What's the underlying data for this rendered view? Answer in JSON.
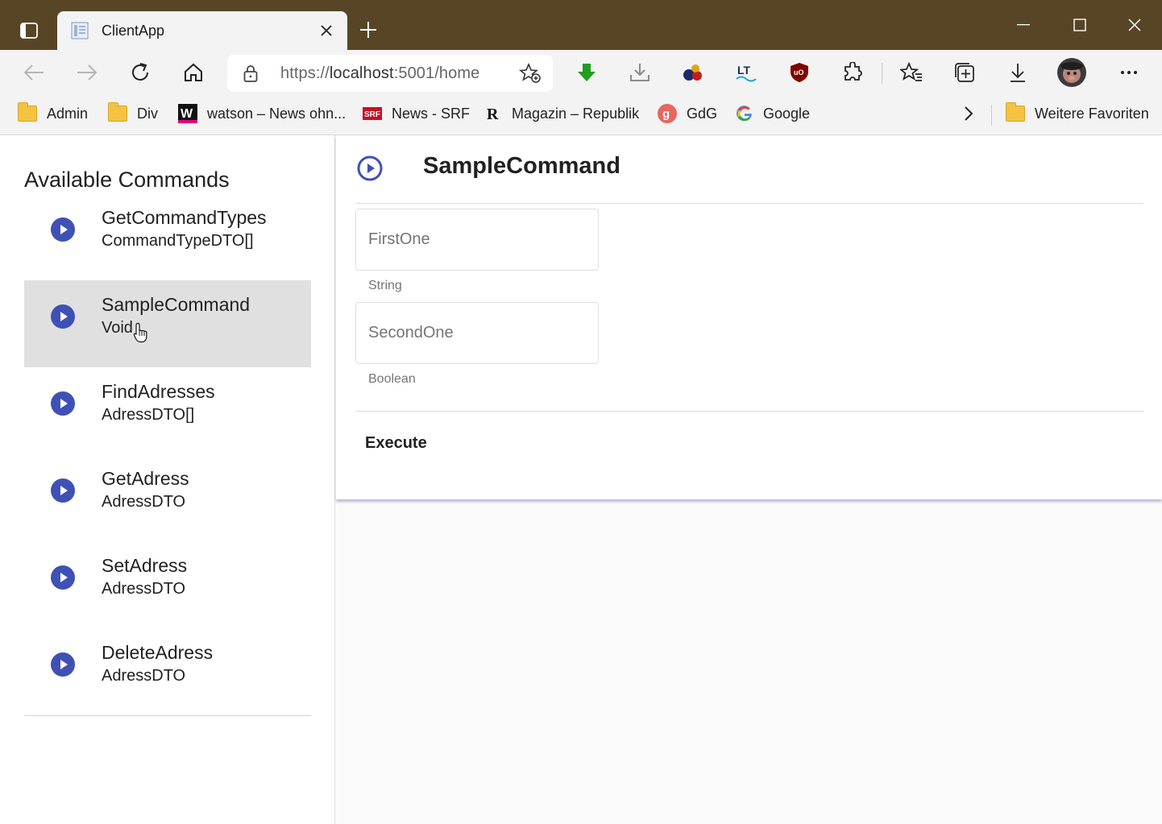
{
  "browser": {
    "tab": {
      "title": "ClientApp"
    },
    "address": {
      "scheme_host": "https://",
      "host": "localhost",
      "rest": ":5001/home"
    },
    "bookmarks": [
      {
        "label": "Admin",
        "icon": "folder-icon"
      },
      {
        "label": "Div",
        "icon": "folder-icon"
      },
      {
        "label": "watson – News ohn...",
        "icon": "watson-icon"
      },
      {
        "label": "News - SRF",
        "icon": "srf-icon"
      },
      {
        "label": "Magazin – Republik",
        "icon": "republik-icon"
      },
      {
        "label": "GdG",
        "icon": "gdg-icon"
      },
      {
        "label": "Google",
        "icon": "google-icon"
      }
    ],
    "other_favorites": "Weitere Favoriten",
    "srf_badge": "SRF",
    "watson_badge": "W",
    "republik_badge": "R",
    "lt_badge": "LT"
  },
  "sidebar": {
    "title": "Available Commands",
    "commands": [
      {
        "name": "GetCommandTypes",
        "type": "CommandTypeDTO[]"
      },
      {
        "name": "SampleCommand",
        "type": "Void"
      },
      {
        "name": "FindAdresses",
        "type": "AdressDTO[]"
      },
      {
        "name": "GetAdress",
        "type": "AdressDTO"
      },
      {
        "name": "SetAdress",
        "type": "AdressDTO"
      },
      {
        "name": "DeleteAdress",
        "type": "AdressDTO"
      }
    ],
    "selected_index": 1
  },
  "main": {
    "title": "SampleCommand",
    "fields": [
      {
        "placeholder": "FirstOne",
        "hint": "String"
      },
      {
        "placeholder": "SecondOne",
        "hint": "Boolean"
      }
    ],
    "execute_label": "Execute"
  },
  "colors": {
    "titlebar": "#574526",
    "accent": "#3f51b5",
    "selected_row": "#e0e0e0"
  }
}
